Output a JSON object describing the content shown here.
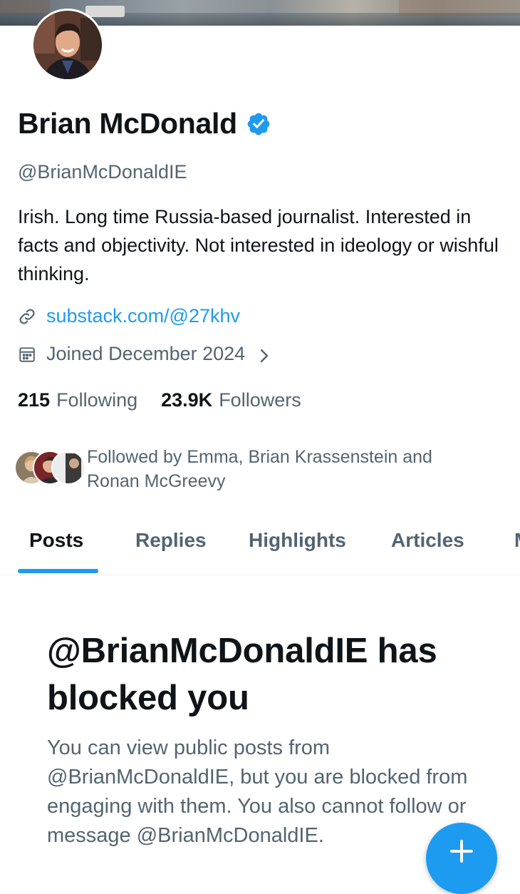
{
  "profile": {
    "name": "Brian McDonald",
    "handle": "@BrianMcDonaldIE",
    "bio": "Irish. Long time Russia-based journalist. Interested in facts and objectivity. Not interested in ideology or wishful thinking.",
    "link": "substack.com/@27khv",
    "joined": "Joined December 2024",
    "following_count": "215",
    "following_label": "Following",
    "followers_count": "23.9K",
    "followers_label": "Followers",
    "followed_by": "Followed by Emma, Brian Krassenstein and Ronan McGreevy",
    "verified": true
  },
  "tabs": [
    "Posts",
    "Replies",
    "Highlights",
    "Articles"
  ],
  "active_tab": "Posts",
  "blocked": {
    "title": "@BrianMcDonaldIE has blocked you",
    "body": "You can view public posts from @BrianMcDonaldIE, but you are blocked from engaging with them. You also cannot follow or message @BrianMcDonaldIE."
  },
  "colors": {
    "accent": "#1d9bf0",
    "text_primary": "#0f1419",
    "text_secondary": "#536471"
  },
  "icons": {
    "verified": "verified-badge-icon",
    "link": "link-icon",
    "calendar": "calendar-icon",
    "chevron": "chevron-right-icon",
    "fab": "plus-icon"
  }
}
